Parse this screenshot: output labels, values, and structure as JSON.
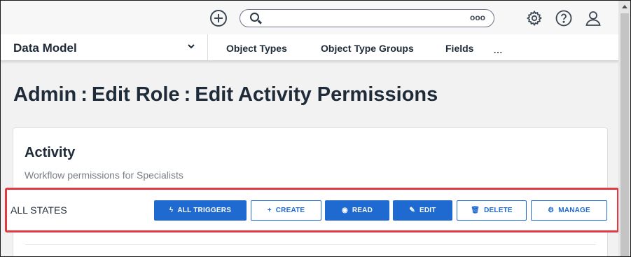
{
  "header": {
    "add_icon": "plus-circle-icon",
    "search": {
      "placeholder": "",
      "options_icon": "ooo"
    },
    "icons": [
      "gear-icon",
      "help-icon",
      "user-icon"
    ]
  },
  "nav": {
    "dropdown_label": "Data Model",
    "tabs": [
      {
        "label": "Object Types"
      },
      {
        "label": "Object Type Groups"
      },
      {
        "label": "Fields"
      }
    ],
    "more": "..."
  },
  "breadcrumb": {
    "parts": [
      "Admin",
      "Edit Role",
      "Edit Activity Permissions"
    ],
    "separator": ":"
  },
  "card": {
    "title": "Activity",
    "description": "Workflow permissions for Specialists"
  },
  "permissions": {
    "row_label": "ALL STATES",
    "buttons": [
      {
        "label": "ALL TRIGGERS",
        "icon": "ϟ",
        "active": true
      },
      {
        "label": "CREATE",
        "icon": "+",
        "active": false
      },
      {
        "label": "READ",
        "icon": "◉",
        "active": true
      },
      {
        "label": "EDIT",
        "icon": "✎",
        "active": true
      },
      {
        "label": "DELETE",
        "icon": "🗑",
        "active": false
      },
      {
        "label": "MANAGE",
        "icon": "⚙",
        "active": false
      }
    ]
  },
  "colors": {
    "accent": "#1f6ad0",
    "highlight": "#e23a42",
    "text": "#1f2b38"
  }
}
